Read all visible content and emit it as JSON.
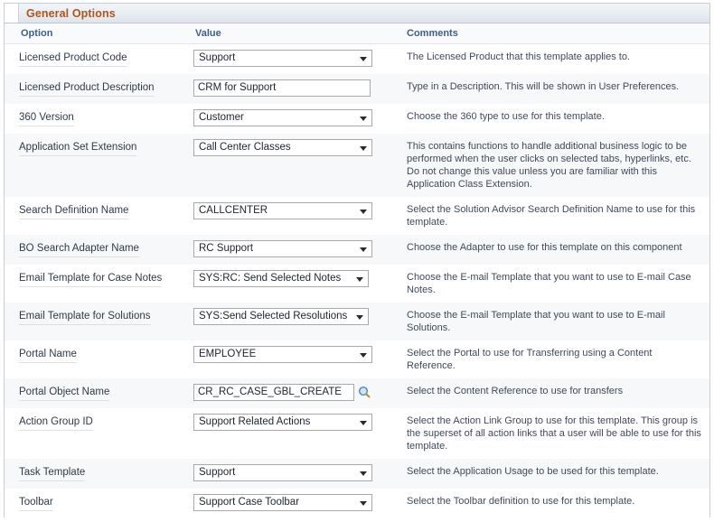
{
  "panel": {
    "title": "General Options"
  },
  "columns": {
    "option": "Option",
    "value": "Value",
    "comments": "Comments"
  },
  "icons": {
    "lookup": "magnifier-icon",
    "dropdown": "chevron-down-icon"
  },
  "colors": {
    "group_title": "#b0541b",
    "column_header_text": "#3f5e88",
    "row_alt": "#f7f8f9",
    "panel_border": "#c8cdd4"
  },
  "rows": [
    {
      "option": "Licensed Product Code",
      "control": "select",
      "value": "Support",
      "comments": "The Licensed Product that this template applies to."
    },
    {
      "option": "Licensed Product Description",
      "control": "text",
      "value": "CRM for Support",
      "comments": "Type in a Description. This will be shown in User Preferences."
    },
    {
      "option": "360 Version",
      "control": "select",
      "value": "Customer",
      "comments": "Choose the 360 type to use for this template."
    },
    {
      "option": "Application Set Extension",
      "control": "select",
      "value": "Call Center Classes",
      "comments": "This contains functions to handle additional business logic to be performed when the user clicks on selected tabs, hyperlinks, etc. Do not change this value unless you are familiar with this Application Class Extension."
    },
    {
      "option": "Search Definition Name",
      "control": "select",
      "value": "CALLCENTER",
      "comments": "Select the Solution Advisor Search Definition Name to use for this template."
    },
    {
      "option": "BO Search Adapter Name",
      "control": "select",
      "value": "RC Support",
      "comments": "Choose the Adapter to use for this template on this component"
    },
    {
      "option": "Email Template for Case Notes",
      "control": "select",
      "value": "SYS:RC: Send Selected Notes",
      "comments": "Choose the E-mail Template that you want to use to E-mail Case Notes."
    },
    {
      "option": "Email Template for Solutions",
      "control": "select",
      "value": "SYS:Send Selected Resolutions",
      "comments": "Choose the E-mail Template that you want to use to E-mail Solutions."
    },
    {
      "option": "Portal Name",
      "control": "select",
      "value": "EMPLOYEE",
      "comments": "Select the Portal to use for Transferring using a Content Reference."
    },
    {
      "option": "Portal Object Name",
      "control": "text-lookup",
      "value": "CR_RC_CASE_GBL_CREATE",
      "comments": "Select the Content Reference to use for transfers"
    },
    {
      "option": "Action Group ID",
      "control": "select",
      "value": "Support Related Actions",
      "comments": "Select the Action Link Group to use for this template. This group is the superset of all action links that a user will be able to use for this template."
    },
    {
      "option": "Task Template",
      "control": "select",
      "value": "Support",
      "comments": "Select the Application Usage to be used for this template."
    },
    {
      "option": "Toolbar",
      "control": "select",
      "value": "Support Case Toolbar",
      "comments": "Select the Toolbar definition to use for this template."
    }
  ]
}
